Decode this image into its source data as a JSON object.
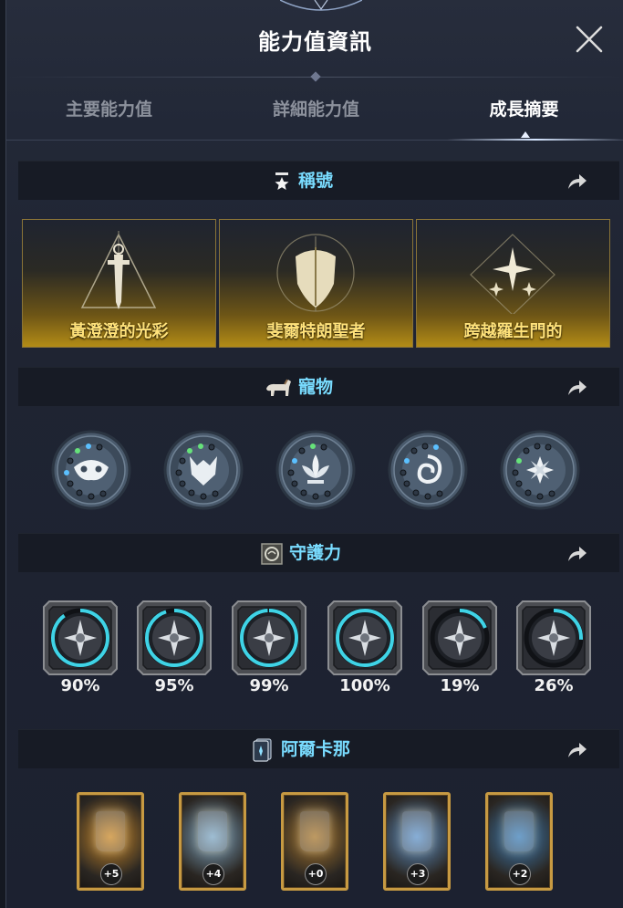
{
  "window": {
    "title": "能力值資訊"
  },
  "tabs": [
    {
      "label": "主要能力值",
      "active": false
    },
    {
      "label": "詳細能力值",
      "active": false
    },
    {
      "label": "成長摘要",
      "active": true
    }
  ],
  "sections": {
    "titles": {
      "label": "稱號",
      "icon": "star-medal-icon",
      "items": [
        {
          "name": "黃澄澄的光彩",
          "icon": "sword-triangle-emblem"
        },
        {
          "name": "斐爾特朗聖者",
          "icon": "shield-emblem"
        },
        {
          "name": "跨越羅生門的",
          "icon": "star-diamond-emblem"
        }
      ]
    },
    "pets": {
      "label": "寵物",
      "icon": "horse-icon",
      "items": [
        {
          "icon": "owl-mask-icon"
        },
        {
          "icon": "wolf-head-icon"
        },
        {
          "icon": "lotus-icon"
        },
        {
          "icon": "vortex-icon"
        },
        {
          "icon": "flower-star-icon"
        }
      ]
    },
    "guardian": {
      "label": "守護力",
      "icon": "guardian-rune-icon",
      "items": [
        {
          "percent": 0.9,
          "label": "90%",
          "icon": "shield-sword-icon"
        },
        {
          "percent": 0.95,
          "label": "95%",
          "icon": "wing-sword-icon"
        },
        {
          "percent": 0.99,
          "label": "99%",
          "icon": "bird-sword-icon"
        },
        {
          "percent": 1.0,
          "label": "100%",
          "icon": "crossed-spears-icon"
        },
        {
          "percent": 0.19,
          "label": "19%",
          "icon": "compass-star-icon"
        },
        {
          "percent": 0.26,
          "label": "26%",
          "icon": "crescent-icon"
        }
      ]
    },
    "arcana": {
      "label": "阿爾卡那",
      "icon": "card-icon",
      "items": [
        {
          "level": "+5",
          "icon": "golden-chalice-card",
          "color": "#c9892a"
        },
        {
          "level": "+4",
          "icon": "stained-window-card",
          "color": "#7ea7c4"
        },
        {
          "level": "+0",
          "icon": "sword-coins-card",
          "color": "#a7772e"
        },
        {
          "level": "+3",
          "icon": "ice-crystal-card",
          "color": "#5f93c9"
        },
        {
          "level": "+2",
          "icon": "water-vortex-card",
          "color": "#3e7fb8"
        }
      ]
    }
  },
  "colors": {
    "accent": "#79dcff",
    "guardian_ring": "#3fd3e6",
    "title_gold": "#ffe27a"
  }
}
